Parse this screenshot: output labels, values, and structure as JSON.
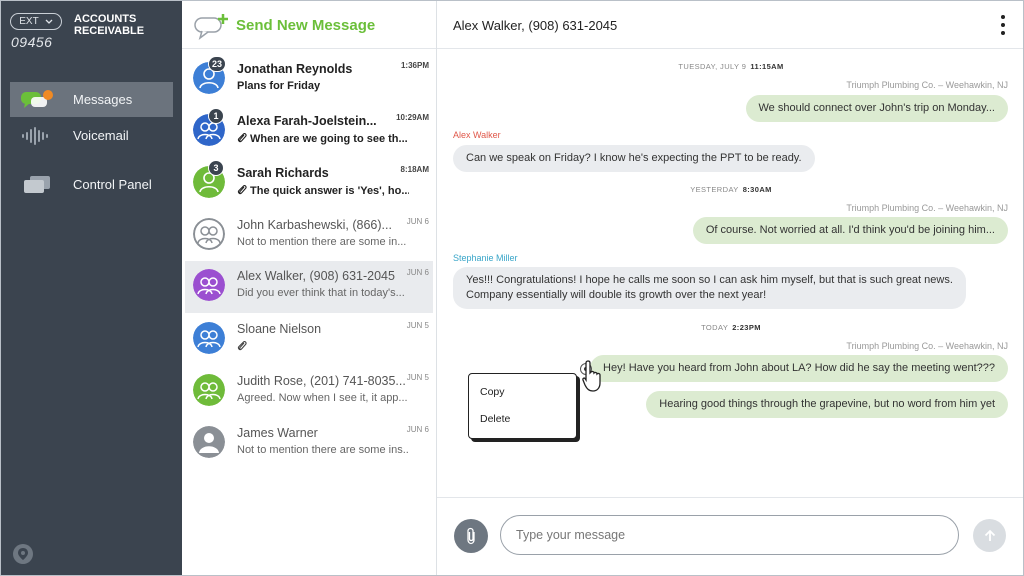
{
  "nav": {
    "ext_label": "EXT",
    "ext_number": "09456",
    "account_title": "ACCOUNTS RECEIVABLE",
    "items": [
      {
        "label": "Messages",
        "icon": "chat-bubbles-icon",
        "active": true
      },
      {
        "label": "Voicemail",
        "icon": "voicemail-waveform-icon",
        "active": false
      },
      {
        "label": "Control Panel",
        "icon": "control-panel-icon",
        "active": false
      }
    ],
    "footer_icon": "location-pin-icon"
  },
  "list": {
    "new_message_label": "Send New Message",
    "conversations": [
      {
        "name": "Jonathan Reynolds",
        "preview": "Plans for Friday",
        "time": "1:36PM",
        "badge": "23",
        "unread": true,
        "attachment": false,
        "avatar_color": "#3d7fd6",
        "avatar_type": "single"
      },
      {
        "name": "Alexa Farah-Joelstein...",
        "preview": "When are we going to see th...",
        "time": "10:29AM",
        "badge": "1",
        "unread": true,
        "attachment": true,
        "avatar_color": "#2f66c9",
        "avatar_type": "group"
      },
      {
        "name": "Sarah Richards",
        "preview": "The quick answer is 'Yes', ho...",
        "time": "8:18AM",
        "badge": "3",
        "unread": true,
        "attachment": true,
        "avatar_color": "#6fbb3a",
        "avatar_type": "single"
      },
      {
        "name": "John Karbashewski, (866)...",
        "preview": "Not to mention there are some in...",
        "time": "JUN 6",
        "badge": "",
        "unread": false,
        "attachment": false,
        "avatar_color": "#8a8f95",
        "avatar_type": "group"
      },
      {
        "name": "Alex Walker, (908) 631-2045",
        "preview": "Did you ever think that in today's...",
        "time": "JUN 6",
        "badge": "",
        "unread": false,
        "attachment": false,
        "avatar_color": "#9b4fd0",
        "avatar_type": "group",
        "selected": true
      },
      {
        "name": "Sloane Nielson",
        "preview": "",
        "time": "JUN 5",
        "badge": "",
        "unread": false,
        "attachment": true,
        "avatar_color": "#3d7fd6",
        "avatar_type": "group"
      },
      {
        "name": "Judith Rose, (201) 741-8035...",
        "preview": "Agreed. Now when I see it, it app...",
        "time": "JUN 5",
        "badge": "",
        "unread": false,
        "attachment": false,
        "avatar_color": "#6fbb3a",
        "avatar_type": "group"
      },
      {
        "name": "James Warner",
        "preview": "Not to mention there are some ins...",
        "time": "JUN 6",
        "badge": "",
        "unread": false,
        "attachment": false,
        "avatar_color": "#8a8f95",
        "avatar_type": "single"
      }
    ]
  },
  "chat": {
    "title": "Alex Walker, (908) 631-2045",
    "dividers": [
      {
        "day": "TUESDAY, JULY 9",
        "time": "11:15AM"
      },
      {
        "day": "YESTERDAY",
        "time": "8:30AM"
      },
      {
        "day": "TODAY",
        "time": "2:23PM"
      }
    ],
    "messages": [
      {
        "direction": "out",
        "sender": "Triumph Plumbing Co. – Weehawkin, NJ",
        "text": "We should connect over John's trip on Monday..."
      },
      {
        "direction": "in",
        "sender": "Alex Walker",
        "sender_color": "#e0584a",
        "text": "Can we speak on Friday? I know he's expecting the PPT to be ready."
      },
      {
        "direction": "out",
        "sender": "Triumph Plumbing Co. – Weehawkin, NJ",
        "text": "Of course. Not worried at all. I'd think you'd be joining him..."
      },
      {
        "direction": "in",
        "sender": "Stephanie Miller",
        "sender_color": "#3aa6c9",
        "text_line1": "Yes!!! Congratulations! I hope he calls me soon so I can ask him myself, but that is such great news.",
        "text_line2": "Company essentially will double its growth over the next year!"
      },
      {
        "direction": "out",
        "sender": "Triumph Plumbing Co. – Weehawkin, NJ",
        "text": "Hey! Have you heard from John about LA? How did he say the meeting went???"
      },
      {
        "direction": "out",
        "sender": "",
        "text": "Hearing good things through the grapevine, but no word from him yet"
      }
    ],
    "context_menu": {
      "copy": "Copy",
      "delete": "Delete"
    },
    "composer": {
      "placeholder": "Type your message",
      "value": ""
    }
  },
  "colors": {
    "nav_bg": "#3b444f",
    "accent_green": "#6bbf3a",
    "outgoing_bubble": "#dcebd1",
    "incoming_bubble": "#eaecef"
  }
}
